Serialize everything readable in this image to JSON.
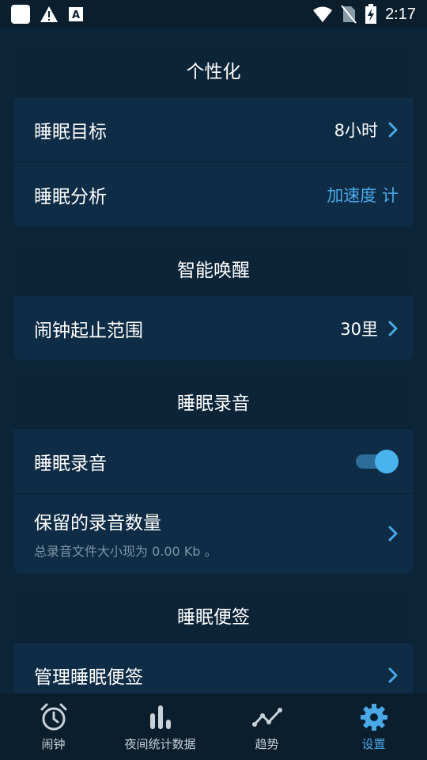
{
  "status_bar": {
    "time": "2:17"
  },
  "sections": {
    "personalize": {
      "title": "个性化",
      "sleep_goal": {
        "label": "睡眠目标",
        "value": "8小时"
      },
      "sleep_analysis": {
        "label": "睡眠分析",
        "value": "加速度 计"
      }
    },
    "smart_wake": {
      "title": "智能唤醒",
      "alarm_range": {
        "label": "闹钟起止范围",
        "value": "30里"
      }
    },
    "recording": {
      "title": "睡眠录音",
      "toggle_row": {
        "label": "睡眠录音",
        "enabled": true
      },
      "keep_count": {
        "label": "保留的录音数量",
        "subtitle": "总录音文件大小现为 0.00 Kb 。"
      }
    },
    "notes": {
      "title": "睡眠便签",
      "manage": {
        "label": "管理睡眠便签"
      }
    }
  },
  "bottom_nav": {
    "items": [
      {
        "label": "闹钟",
        "icon": "alarm-clock-icon"
      },
      {
        "label": "夜间统计数据",
        "icon": "bar-chart-icon"
      },
      {
        "label": "趋势",
        "icon": "trend-line-icon"
      },
      {
        "label": "设置",
        "icon": "gear-icon"
      }
    ],
    "active": "设置"
  },
  "colors": {
    "accent": "#49a9e8",
    "background": "#0c2538",
    "card": "#0e2c45"
  }
}
